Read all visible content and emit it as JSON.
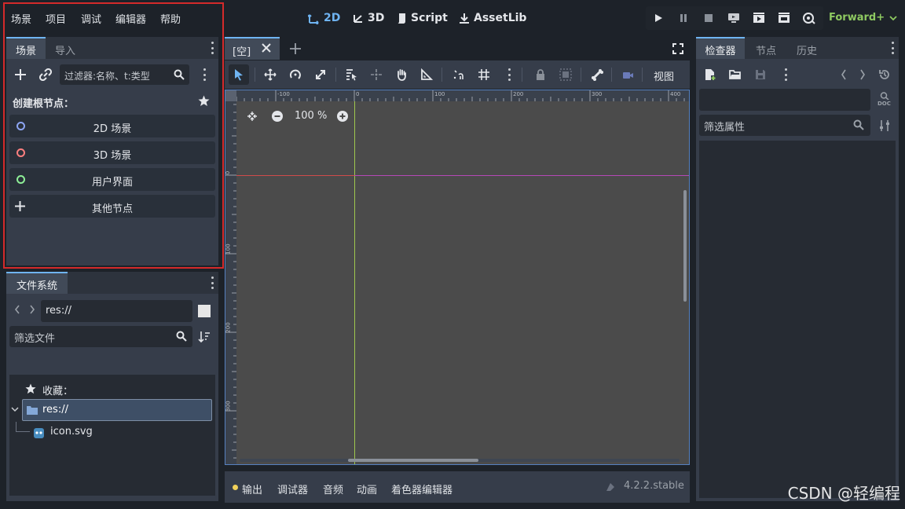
{
  "menu": [
    "场景",
    "项目",
    "调试",
    "编辑器",
    "帮助"
  ],
  "workspaces": {
    "w2d": "2D",
    "w3d": "3D",
    "script": "Script",
    "assetlib": "AssetLib"
  },
  "renderer": "Forward+",
  "scene_dock": {
    "tabs": [
      "场景",
      "导入"
    ],
    "filter_placeholder": "过滤器:名称、t:类型",
    "create_root_label": "创建根节点：",
    "nodes": [
      {
        "label": "2D 场景",
        "color": "#8da5f3"
      },
      {
        "label": "3D 场景",
        "color": "#fc7f7f"
      },
      {
        "label": "用户界面",
        "color": "#8eef97"
      },
      {
        "label": "其他节点",
        "color": "#e0e0e0"
      }
    ]
  },
  "filesystem_dock": {
    "tab": "文件系统",
    "path": "res://",
    "filter_placeholder": "筛选文件",
    "favorites_label": "收藏：",
    "root": "res://",
    "files": [
      "icon.svg"
    ]
  },
  "viewport": {
    "scene_tab": "[空]",
    "zoom": "100 %",
    "view_menu": "视图",
    "ruler_top": [
      "-100",
      "0",
      "100",
      "200",
      "300",
      "400"
    ],
    "ruler_left": [
      "0",
      "100",
      "200",
      "300"
    ]
  },
  "bottom_panel": {
    "items": [
      "输出",
      "调试器",
      "音频",
      "动画",
      "着色器编辑器"
    ],
    "version": "4.2.2.stable"
  },
  "inspector": {
    "tabs": [
      "检查器",
      "节点",
      "历史"
    ],
    "filter_placeholder": "筛选属性",
    "doc_label": "DOC"
  },
  "watermark": "CSDN @轻编程"
}
